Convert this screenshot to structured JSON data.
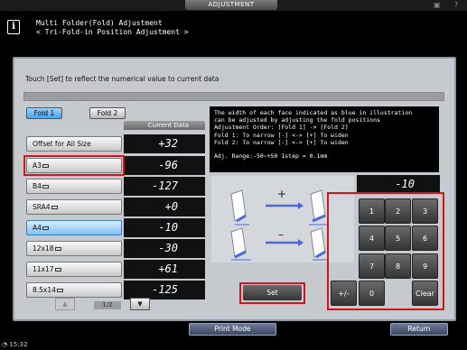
{
  "top": {
    "tab_label": "ADJUSTMENT",
    "help_label": "?",
    "lock_icon": "lock-icon"
  },
  "header": {
    "icon": "info-icon",
    "title": "Multi Folder(Fold) Adjustment",
    "subtitle": "< Tri-Fold-in Position Adjustment >"
  },
  "instruction": "Touch [Set] to reflect the numerical value to current data",
  "tabs": [
    {
      "label": "Fold 1",
      "selected": true
    },
    {
      "label": "Fold 2",
      "selected": false
    }
  ],
  "current_data_header": "Current Data",
  "rows": [
    {
      "label": "Offset for All Size",
      "value": "+32",
      "selected": false
    },
    {
      "label": "A3",
      "value": "-96",
      "selected": false
    },
    {
      "label": "B4",
      "value": "-127",
      "selected": false
    },
    {
      "label": "SRA4",
      "value": "+0",
      "selected": false
    },
    {
      "label": "A4",
      "value": "-10",
      "selected": true
    },
    {
      "label": "12x18",
      "value": "-30",
      "selected": false
    },
    {
      "label": "11x17",
      "value": "+61",
      "selected": false
    },
    {
      "label": "8.5x14",
      "value": "-125",
      "selected": false
    }
  ],
  "pager": {
    "up": "▲",
    "page": "1/2",
    "down": "▼"
  },
  "description": {
    "line1": "The width of each face indicated as blue in illustration",
    "line2": "can be adjusted by adjusting the fold positions",
    "line3": "Adjustment Order: [Fold 1] -> [Fold 2]",
    "line4": "Fold 1: To narrow [-]  <->  [+] To widen",
    "line5": "Fold 2: To narrow [-]  <->  [+] To widen",
    "line6": "Adj. Range:-50~+50 1step = 0.1mm"
  },
  "illustration": {
    "plus": "+",
    "minus": "–"
  },
  "input_value": "-10",
  "keypad": [
    "1",
    "2",
    "3",
    "4",
    "5",
    "6",
    "7",
    "8",
    "9",
    "+/-",
    "0",
    "Clear"
  ],
  "set_label": "Set",
  "bottom": {
    "print_mode": "Print Mode",
    "return": "Return",
    "clock": "15:32"
  },
  "colors": {
    "accent": "#4aa3e8",
    "highlight": "#d4141c"
  }
}
